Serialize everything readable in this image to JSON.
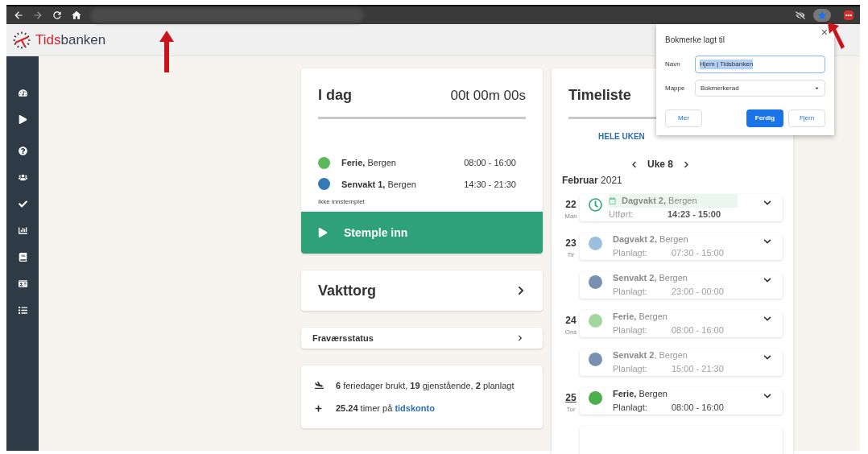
{
  "app": {
    "brand_prefix": "Tids",
    "brand_suffix": "banken"
  },
  "today": {
    "title": "I dag",
    "timer": "00t 00m 00s",
    "shifts": [
      {
        "name": "Ferie,",
        "place": "Bergen",
        "time": "08:00 - 16:00",
        "color": "#5cb85c"
      },
      {
        "name": "Senvakt 1,",
        "place": "Bergen",
        "time": "14:30 - 21:30",
        "color": "#337ab7"
      }
    ],
    "status": "Ikke innstemplet",
    "button": "Stemple inn"
  },
  "vakttorg": {
    "title": "Vakttorg"
  },
  "absence": {
    "title": "Fraværsstatus"
  },
  "stats": {
    "vacation": "**6** feriedager brukt, **19** gjenstående, **2** planlagt",
    "account": "**25.24** timer på",
    "account_link": "tidskonto"
  },
  "timeliste": {
    "title": "Timeliste",
    "tab": "HELE UKEN",
    "week": "Uke 8",
    "month": "Februar",
    "year": "2021",
    "days": [
      {
        "date": "22",
        "weekday": "Man",
        "today": false,
        "entries": [
          {
            "kind": "worked",
            "name": "Dagvakt 2,",
            "place": "Bergen",
            "label": "Utført:",
            "time": "14:23 - 15:00",
            "dimmed": true
          }
        ]
      },
      {
        "date": "23",
        "weekday": "Tir",
        "today": false,
        "entries": [
          {
            "kind": "planned",
            "name": "Dagvakt 2,",
            "place": "Bergen",
            "label": "Planlagt:",
            "time": "07:30 - 15:00",
            "color": "#9bbfdf",
            "dimmed": true
          },
          {
            "kind": "planned",
            "name": "Senvakt 2,",
            "place": "Bergen",
            "label": "Planlagt:",
            "time": "23:00 - 00:00",
            "color": "#7891b0",
            "dimmed": true
          }
        ]
      },
      {
        "date": "24",
        "weekday": "Ons",
        "today": false,
        "entries": [
          {
            "kind": "planned",
            "name": "Ferie,",
            "place": "Bergen",
            "label": "Planlagt:",
            "time": "08:00 - 16:00",
            "color": "#a2d8a0",
            "dimmed": true
          },
          {
            "kind": "planned",
            "name": "Senvakt 2",
            "place_text": ", Bergen",
            "label": "Planlagt:",
            "time": "15:00 - 21:30",
            "color": "#7891b0",
            "dimmed": true
          }
        ]
      },
      {
        "date": "25",
        "weekday": "Tor",
        "today": true,
        "entries": [
          {
            "kind": "planned",
            "name": "Ferie,",
            "place": "Bergen",
            "label": "Planlagt:",
            "time": "08:00 - 16:00",
            "color": "#4cae4c",
            "dimmed": false
          }
        ]
      }
    ]
  },
  "bookmark_popup": {
    "title": "Bokmerke lagt til",
    "close": "×",
    "fields": [
      {
        "kind": "input",
        "label": "Navn",
        "value": "Hjem | Tidsbanken"
      },
      {
        "kind": "select",
        "label": "Mappe",
        "value": "Bokmerkerad"
      }
    ],
    "buttons": [
      {
        "label": "Mer",
        "primary": false
      },
      {
        "label": "Ferdig",
        "primary": true
      },
      {
        "label": "Fjern",
        "primary": false
      }
    ]
  }
}
